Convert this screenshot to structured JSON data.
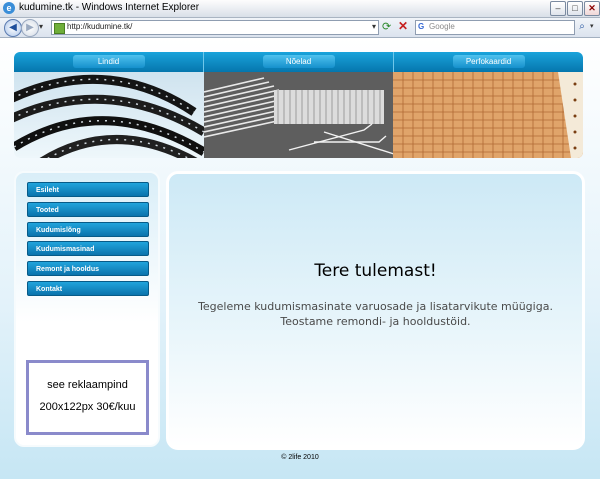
{
  "browser": {
    "title": "kudumine.tk - Windows Internet Explorer",
    "url": "http://kudumine.tk/",
    "search_placeholder": "Google",
    "search_provider_icon": "G"
  },
  "nav": {
    "items": [
      {
        "label": "Lindid"
      },
      {
        "label": "Nõelad"
      },
      {
        "label": "Perfokaardid"
      }
    ]
  },
  "sidebar": {
    "items": [
      {
        "label": "Esileht"
      },
      {
        "label": "Tooted"
      },
      {
        "label": "Kudumislõng"
      },
      {
        "label": "Kudumismasinad"
      },
      {
        "label": "Remont ja hooldus"
      },
      {
        "label": "Kontakt"
      }
    ],
    "ad": {
      "line1": "see reklaampind",
      "line2": "200x122px 30€/kuu"
    }
  },
  "content": {
    "heading": "Tere tulemast!",
    "line1": "Tegeleme kudumismasinate varuosade ja lisatarvikute müügiga.",
    "line2": "Teostame remondi- ja hooldustöid."
  },
  "footer": {
    "text": "© 2life 2010"
  },
  "colors": {
    "nav_blue": "#0a7fb8",
    "menu_blue": "#1592cf",
    "ad_border": "#8a8acb"
  }
}
